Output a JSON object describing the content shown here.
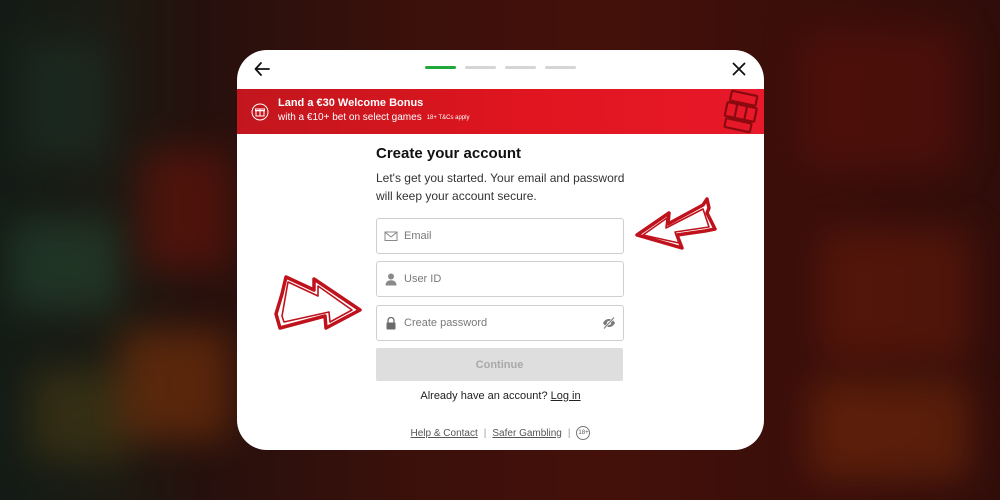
{
  "nav": {
    "back_icon": "arrow-left-icon",
    "close_icon": "close-icon",
    "steps_total": 4,
    "step_current": 1
  },
  "banner": {
    "title": "Land a €30 Welcome Bonus",
    "subtitle": "with a €10+ bet on select games",
    "terms": "18+ T&Cs apply",
    "icon": "gift-icon",
    "art": "slot-machine-icon"
  },
  "form": {
    "heading": "Create your account",
    "description_line1": "Let's get you started. Your email and password",
    "description_line2": "will keep your account secure.",
    "email": {
      "placeholder": "Email",
      "value": "",
      "icon": "envelope-icon"
    },
    "user_id": {
      "placeholder": "User ID",
      "value": "",
      "icon": "user-icon"
    },
    "password": {
      "placeholder": "Create password",
      "value": "",
      "icon": "lock-icon",
      "toggle_icon": "eye-slash-icon"
    },
    "continue_label": "Continue",
    "continue_enabled": false,
    "login_prompt": "Already have an account?",
    "login_link": "Log in"
  },
  "footer": {
    "help_link": "Help & Contact",
    "safer_link": "Safer Gambling",
    "age_badge": "18+"
  },
  "colors": {
    "accent_red": "#e0151f",
    "progress_green": "#22a83a",
    "annotation_red": "#c0121c"
  }
}
